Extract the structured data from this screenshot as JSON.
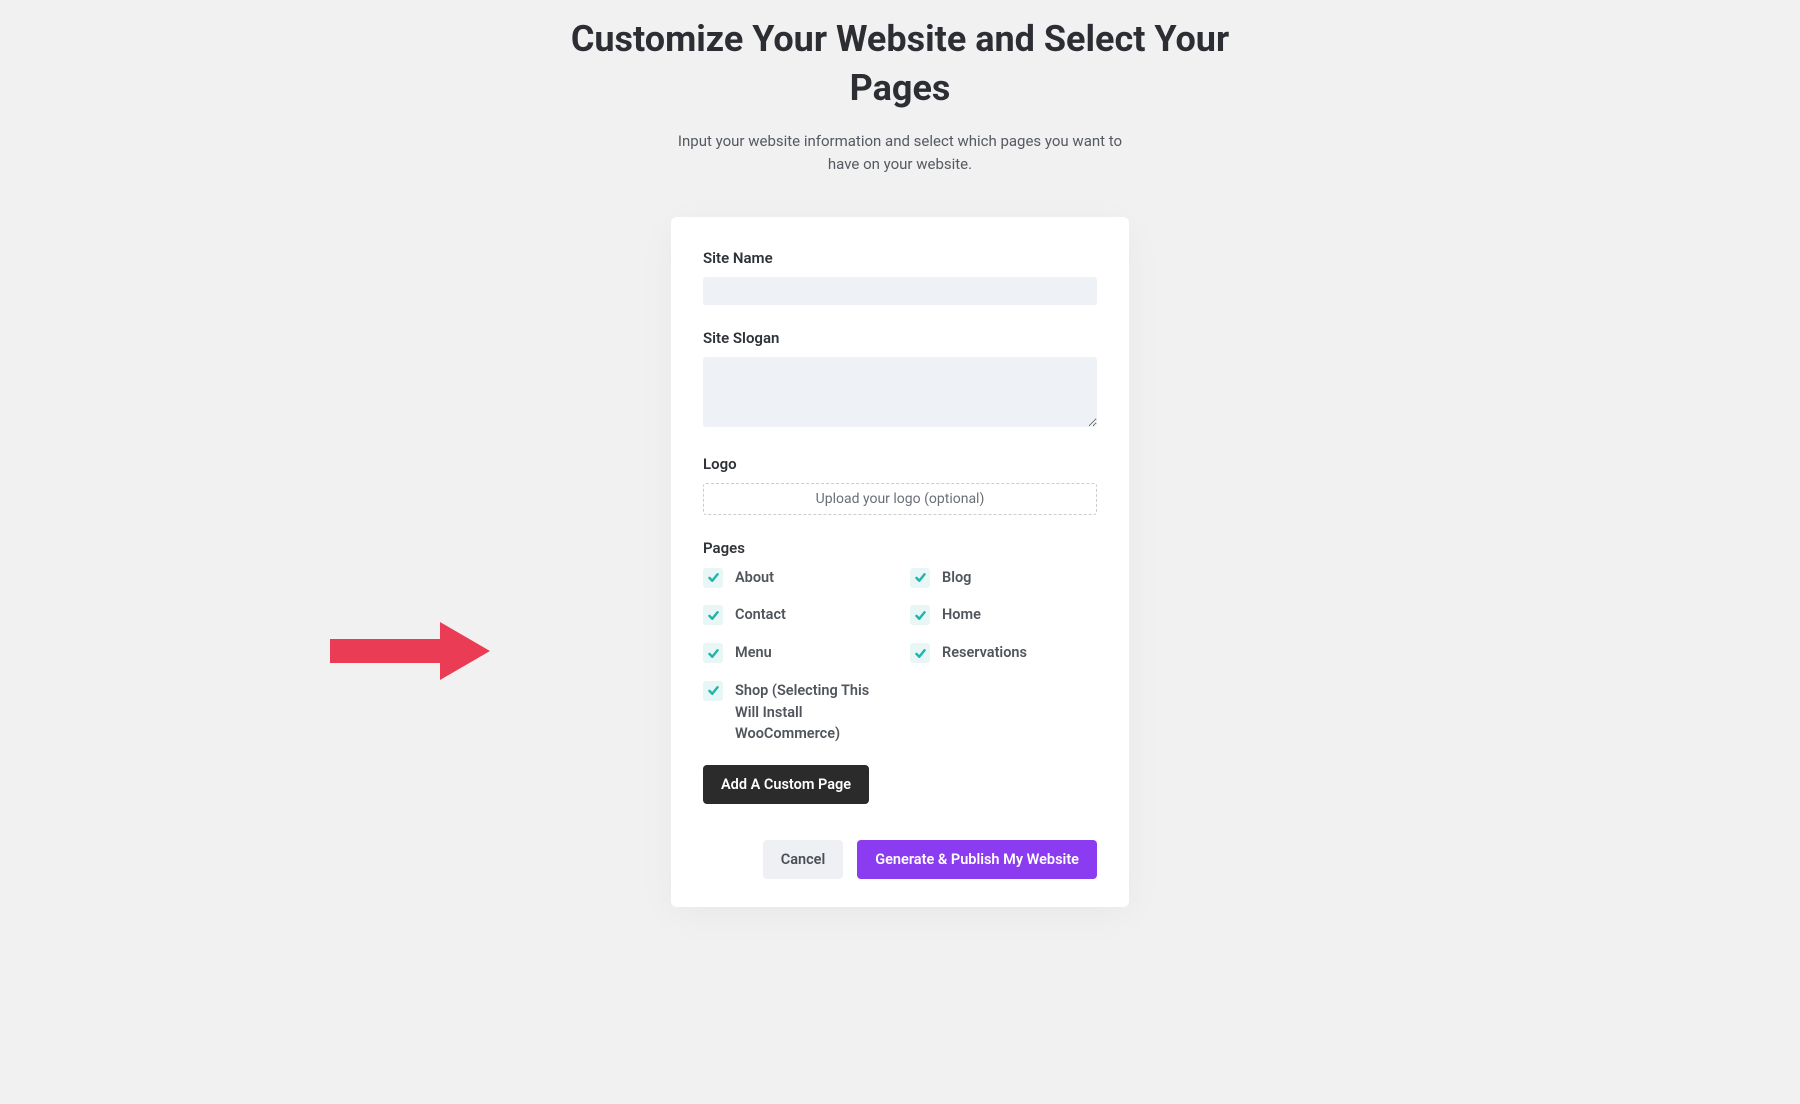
{
  "header": {
    "title": "Customize Your Website and Select Your Pages",
    "subtitle": "Input your website information and select which pages you want to have on your website."
  },
  "form": {
    "site_name": {
      "label": "Site Name",
      "value": ""
    },
    "site_slogan": {
      "label": "Site Slogan",
      "value": ""
    },
    "logo": {
      "label": "Logo",
      "upload_text": "Upload your logo (optional)"
    },
    "pages": {
      "label": "Pages",
      "items": [
        {
          "label": "About",
          "checked": true
        },
        {
          "label": "Blog",
          "checked": true
        },
        {
          "label": "Contact",
          "checked": true
        },
        {
          "label": "Home",
          "checked": true
        },
        {
          "label": "Menu",
          "checked": true
        },
        {
          "label": "Reservations",
          "checked": true
        },
        {
          "label": "Shop (Selecting This Will Install WooCommerce)",
          "checked": true
        }
      ]
    },
    "add_custom_page_label": "Add A Custom Page"
  },
  "buttons": {
    "cancel": "Cancel",
    "generate": "Generate & Publish My Website"
  },
  "annotation": {
    "arrow_color": "#ea3c54"
  }
}
